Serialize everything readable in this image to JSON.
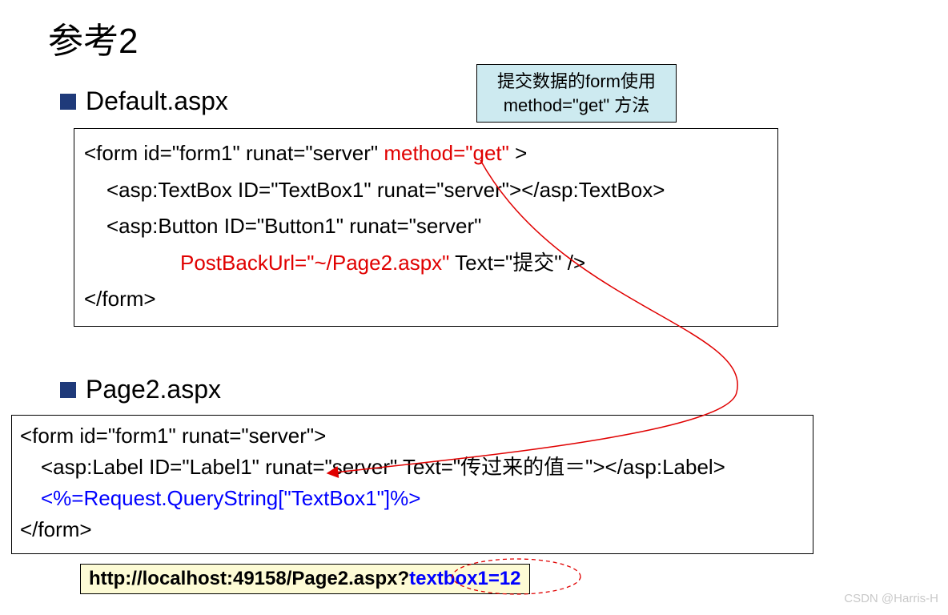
{
  "title": "参考2",
  "sections": {
    "default": "Default.aspx",
    "page2": "Page2.aspx"
  },
  "callout": {
    "line1": "提交数据的form使用",
    "line2": "method=\"get\" 方法"
  },
  "code1": {
    "l1a": "<form id=\"form1\" runat=\"server\"  ",
    "l1b": "method=\"get\"",
    "l1c": " >",
    "l2": "<asp:TextBox ID=\"TextBox1\" runat=\"server\"></asp:TextBox>",
    "l3": "<asp:Button ID=\"Button1\" runat=\"server\"",
    "l4a": "PostBackUrl=\"~/Page2.aspx\"",
    "l4b": " Text=\"提交\" />",
    "l5": "</form>"
  },
  "code2": {
    "l1": "<form id=\"form1\" runat=\"server\">",
    "l2": "<asp:Label ID=\"Label1\" runat=\"server\" Text=\"传过来的值＝\"></asp:Label>",
    "l3": "<%=Request.QueryString[\"TextBox1\"]%>",
    "l4": "</form>"
  },
  "url": {
    "prefix": "http://localhost:49158/Page2.aspx?",
    "query": "textbox1=12"
  },
  "watermark": "CSDN @Harris-H"
}
